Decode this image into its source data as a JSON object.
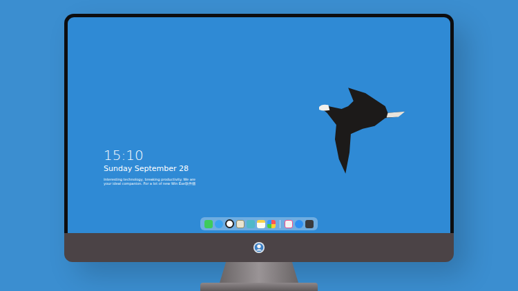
{
  "lockscreen": {
    "time": "15:10",
    "date": "Sunday September 28",
    "tagline": [
      "Interesting technology, breaking productivity. We are",
      "your ideal companion. For a lot of new Win Exe软件猫"
    ]
  }
}
